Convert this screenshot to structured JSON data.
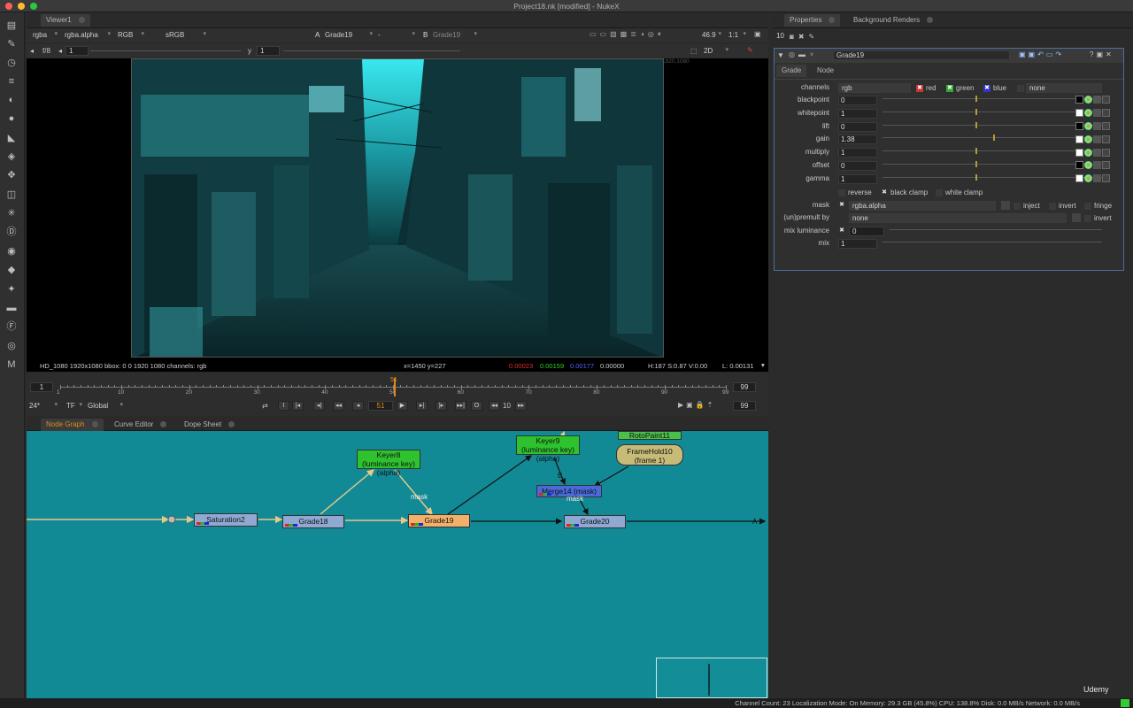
{
  "window": {
    "title": "Project18.nk [modified] - NukeX"
  },
  "viewer_tab": {
    "label": "Viewer1"
  },
  "viewer_controls": {
    "channels": "rgba",
    "alpha": "rgba.alpha",
    "colorspace": "RGB",
    "lut": "sRGB",
    "input_a_letter": "A",
    "input_a": "Grade19",
    "input_mid": "-",
    "input_b_letter": "B",
    "input_b": "Grade19",
    "zoom": "46.9",
    "ratio": "1:1",
    "view_mode": "2D",
    "fstop": "f/8",
    "fstop_value": "1",
    "y_label": "y",
    "y_value": "1"
  },
  "viewer_info": {
    "format": "HD_1080 1920x1080  bbox: 0 0 1920 1080 channels: rgb",
    "coords": "x=1450 y=227",
    "r": "0.00023",
    "g": "0.00159",
    "b": "0.00177",
    "a": "0.00000",
    "hsv": "H:187 S:0.87 V:0.00",
    "l": "L: 0.00131",
    "corner": "1920,1080"
  },
  "timeline": {
    "start": "1",
    "end": "99",
    "end2": "99",
    "ticks": [
      "1",
      "10",
      "20",
      "30",
      "40",
      "50",
      "60",
      "70",
      "80",
      "90",
      "99"
    ],
    "current_frame_marker": "51",
    "fps": "24*",
    "tf": "TF",
    "scope": "Global",
    "frame_input": "51",
    "step": "10",
    "end_frame": "99",
    "buttons": [
      "I",
      "|◂",
      "◂|",
      "◂◂",
      "◂",
      "▶",
      "▸|",
      "|▸",
      "▸▸|",
      "O",
      "◂◂",
      "▸▸"
    ]
  },
  "bottom_tabs": [
    {
      "label": "Node Graph"
    },
    {
      "label": "Curve Editor"
    },
    {
      "label": "Dope Sheet"
    }
  ],
  "nodes": {
    "saturation2": "Saturation2",
    "grade18": "Grade18",
    "grade19": "Grade19",
    "grade20": "Grade20",
    "keyer8_line1": "Keyer8 (luminance key)",
    "keyer8_line2": "(alpha)",
    "keyer9_line1": "Keyer9 (luminance key)",
    "keyer9_line2": "(alpha)",
    "merge14": "Merge14 (mask)",
    "rotopaint11": "RotoPaint11",
    "framehold_line1": "FrameHold10",
    "framehold_line2": "(frame 1)",
    "edge_mask1": "mask",
    "edge_mask2": "mask",
    "edge_b": "B",
    "edge_a": "A"
  },
  "properties_tabs": [
    {
      "label": "Properties"
    },
    {
      "label": "Background Renders"
    }
  ],
  "properties": {
    "max_panels": "10",
    "node_name": "Grade19",
    "tabs": [
      "Grade",
      "Node"
    ],
    "channels": {
      "label": "channels",
      "value": "rgb",
      "red": "red",
      "green": "green",
      "blue": "blue",
      "extra": "none"
    },
    "params": [
      {
        "label": "blackpoint",
        "value": "0"
      },
      {
        "label": "whitepoint",
        "value": "1"
      },
      {
        "label": "lift",
        "value": "0"
      },
      {
        "label": "gain",
        "value": "1.38"
      },
      {
        "label": "multiply",
        "value": "1"
      },
      {
        "label": "offset",
        "value": "0"
      },
      {
        "label": "gamma",
        "value": "1"
      }
    ],
    "reverse": "reverse",
    "black_clamp": "black clamp",
    "white_clamp": "white clamp",
    "mask": {
      "label": "mask",
      "value": "rgba.alpha",
      "inject": "inject",
      "invert": "invert",
      "fringe": "fringe"
    },
    "unpremult": {
      "label": "(un)premult by",
      "value": "none",
      "invert": "invert"
    },
    "mix_luminance": {
      "label": "mix luminance",
      "value": "0"
    },
    "mix": {
      "label": "mix",
      "value": "1"
    }
  },
  "status": {
    "text": "Channel Count: 23  Localization Mode: On  Memory: 29.3 GB (45.8%)  CPU: 138.8%  Disk: 0.0 MB/s  Network: 0.0 MB/s",
    "watermark": "Udemy"
  }
}
